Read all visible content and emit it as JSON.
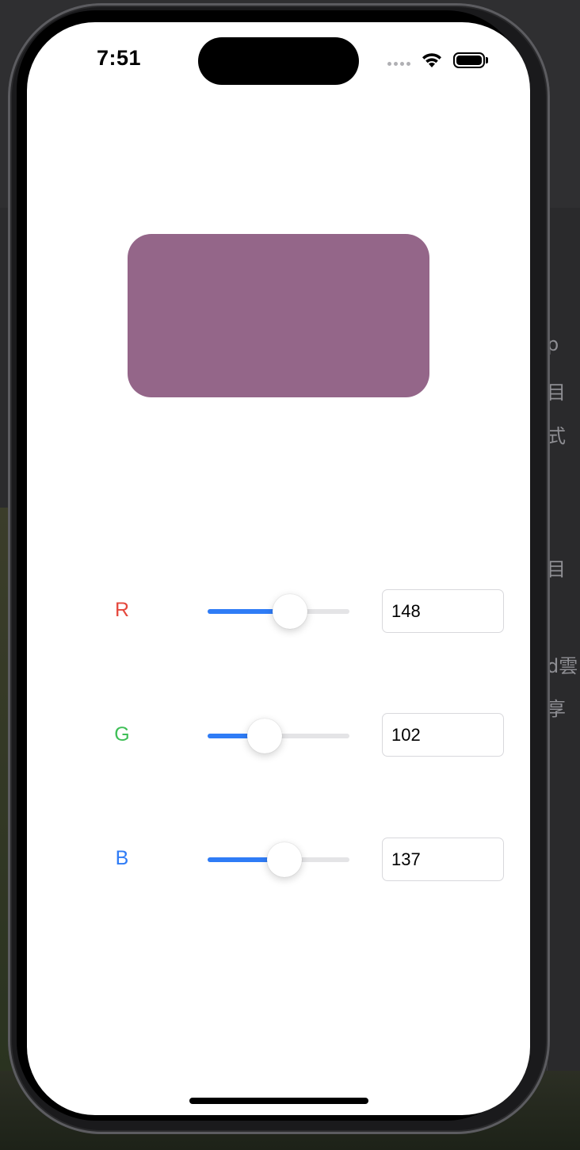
{
  "status_bar": {
    "time": "7:51"
  },
  "background_side_text": [
    "p",
    "目",
    "式",
    "目",
    "d雲",
    "享"
  ],
  "color_preview": {
    "color": "#946689"
  },
  "channels": [
    {
      "label": "R",
      "value": "148",
      "label_color": "#e5483d",
      "slider_fraction": 0.58
    },
    {
      "label": "G",
      "value": "102",
      "label_color": "#3fbf57",
      "slider_fraction": 0.4
    },
    {
      "label": "B",
      "value": "137",
      "label_color": "#2f7cf6",
      "slider_fraction": 0.54
    }
  ],
  "accent_color": "#2f7cf6"
}
